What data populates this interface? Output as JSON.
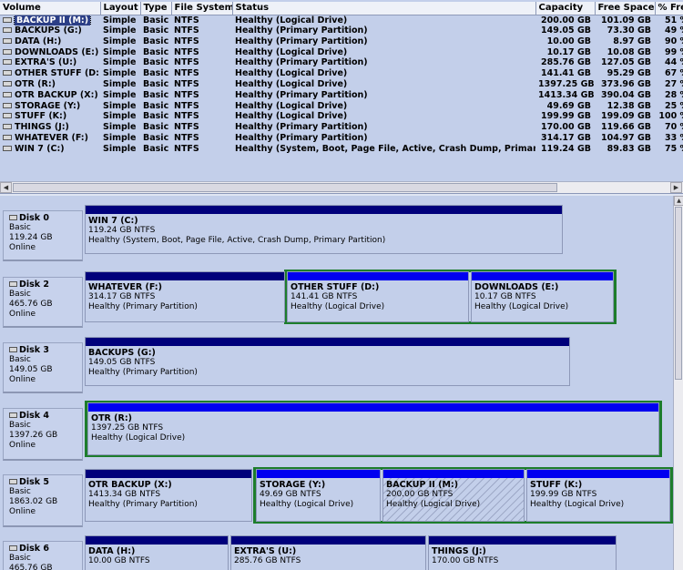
{
  "columns": [
    "Volume",
    "Layout",
    "Type",
    "File System",
    "Status",
    "Capacity",
    "Free Space",
    "% Fre"
  ],
  "volumes": [
    {
      "name": "BACKUP II (M:)",
      "layout": "Simple",
      "type": "Basic",
      "fs": "NTFS",
      "status": "Healthy (Logical Drive)",
      "capacity": "200.00 GB",
      "free": "101.09 GB",
      "pct": "51 %"
    },
    {
      "name": "BACKUPS (G:)",
      "layout": "Simple",
      "type": "Basic",
      "fs": "NTFS",
      "status": "Healthy (Primary Partition)",
      "capacity": "149.05 GB",
      "free": "73.30 GB",
      "pct": "49 %"
    },
    {
      "name": "DATA (H:)",
      "layout": "Simple",
      "type": "Basic",
      "fs": "NTFS",
      "status": "Healthy (Primary Partition)",
      "capacity": "10.00 GB",
      "free": "8.97 GB",
      "pct": "90 %"
    },
    {
      "name": "DOWNLOADS (E:)",
      "layout": "Simple",
      "type": "Basic",
      "fs": "NTFS",
      "status": "Healthy (Logical Drive)",
      "capacity": "10.17 GB",
      "free": "10.08 GB",
      "pct": "99 %"
    },
    {
      "name": "EXTRA'S (U:)",
      "layout": "Simple",
      "type": "Basic",
      "fs": "NTFS",
      "status": "Healthy (Primary Partition)",
      "capacity": "285.76 GB",
      "free": "127.05 GB",
      "pct": "44 %"
    },
    {
      "name": "OTHER STUFF (D:)",
      "layout": "Simple",
      "type": "Basic",
      "fs": "NTFS",
      "status": "Healthy (Logical Drive)",
      "capacity": "141.41 GB",
      "free": "95.29 GB",
      "pct": "67 %"
    },
    {
      "name": "OTR (R:)",
      "layout": "Simple",
      "type": "Basic",
      "fs": "NTFS",
      "status": "Healthy (Logical Drive)",
      "capacity": "1397.25 GB",
      "free": "373.96 GB",
      "pct": "27 %"
    },
    {
      "name": "OTR BACKUP (X:)",
      "layout": "Simple",
      "type": "Basic",
      "fs": "NTFS",
      "status": "Healthy (Primary Partition)",
      "capacity": "1413.34 GB",
      "free": "390.04 GB",
      "pct": "28 %"
    },
    {
      "name": "STORAGE (Y:)",
      "layout": "Simple",
      "type": "Basic",
      "fs": "NTFS",
      "status": "Healthy (Logical Drive)",
      "capacity": "49.69 GB",
      "free": "12.38 GB",
      "pct": "25 %"
    },
    {
      "name": "STUFF (K:)",
      "layout": "Simple",
      "type": "Basic",
      "fs": "NTFS",
      "status": "Healthy (Logical Drive)",
      "capacity": "199.99 GB",
      "free": "199.09 GB",
      "pct": "100 %"
    },
    {
      "name": "THINGS (J:)",
      "layout": "Simple",
      "type": "Basic",
      "fs": "NTFS",
      "status": "Healthy (Primary Partition)",
      "capacity": "170.00 GB",
      "free": "119.66 GB",
      "pct": "70 %"
    },
    {
      "name": "WHATEVER (F:)",
      "layout": "Simple",
      "type": "Basic",
      "fs": "NTFS",
      "status": "Healthy (Primary Partition)",
      "capacity": "314.17 GB",
      "free": "104.97 GB",
      "pct": "33 %"
    },
    {
      "name": "WIN 7 (C:)",
      "layout": "Simple",
      "type": "Basic",
      "fs": "NTFS",
      "status": "Healthy (System, Boot, Page File, Active, Crash Dump, Primar...",
      "capacity": "119.24 GB",
      "free": "89.83 GB",
      "pct": "75 %"
    }
  ],
  "disks": [
    {
      "name": "Disk 0",
      "type": "Basic",
      "size": "119.24 GB",
      "state": "Online",
      "partitions": [
        {
          "name": "WIN 7  (C:)",
          "size": "119.24 GB NTFS",
          "status": "Healthy (System, Boot, Page File, Active, Crash Dump, Primary Partition)"
        }
      ]
    },
    {
      "name": "Disk 2",
      "type": "Basic",
      "size": "465.76 GB",
      "state": "Online",
      "partitions": [
        {
          "name": "WHATEVER  (F:)",
          "size": "314.17 GB NTFS",
          "status": "Healthy (Primary Partition)"
        },
        {
          "name": "OTHER STUFF  (D:)",
          "size": "141.41 GB NTFS",
          "status": "Healthy (Logical Drive)"
        },
        {
          "name": "DOWNLOADS  (E:)",
          "size": "10.17 GB NTFS",
          "status": "Healthy (Logical Drive)"
        }
      ]
    },
    {
      "name": "Disk 3",
      "type": "Basic",
      "size": "149.05 GB",
      "state": "Online",
      "partitions": [
        {
          "name": "BACKUPS  (G:)",
          "size": "149.05 GB NTFS",
          "status": "Healthy (Primary Partition)"
        }
      ]
    },
    {
      "name": "Disk 4",
      "type": "Basic",
      "size": "1397.26 GB",
      "state": "Online",
      "partitions": [
        {
          "name": "OTR  (R:)",
          "size": "1397.25 GB NTFS",
          "status": "Healthy (Logical Drive)"
        }
      ]
    },
    {
      "name": "Disk 5",
      "type": "Basic",
      "size": "1863.02 GB",
      "state": "Online",
      "partitions": [
        {
          "name": "OTR BACKUP  (X:)",
          "size": "1413.34 GB NTFS",
          "status": "Healthy (Primary Partition)"
        },
        {
          "name": "STORAGE  (Y:)",
          "size": "49.69 GB NTFS",
          "status": "Healthy (Logical Drive)"
        },
        {
          "name": "BACKUP II  (M:)",
          "size": "200.00 GB NTFS",
          "status": "Healthy (Logical Drive)"
        },
        {
          "name": "STUFF  (K:)",
          "size": "199.99 GB NTFS",
          "status": "Healthy (Logical Drive)"
        }
      ]
    },
    {
      "name": "Disk 6",
      "type": "Basic",
      "size": "465.76 GB",
      "state": "",
      "partitions": [
        {
          "name": "DATA  (H:)",
          "size": "10.00 GB NTFS",
          "status": ""
        },
        {
          "name": "EXTRA'S  (U:)",
          "size": "285.76 GB NTFS",
          "status": ""
        },
        {
          "name": "THINGS  (J:)",
          "size": "170.00 GB NTFS",
          "status": ""
        }
      ]
    }
  ],
  "colors": {
    "primary_bar": "#00007b",
    "logical_bar": "#0000f0",
    "extended_border": "#1d7d2c",
    "selection": "#2b3e86",
    "background": "#c3cfea"
  },
  "selected_volume": "BACKUP II (M:)",
  "hatched_partition": "BACKUP II  (M:)"
}
